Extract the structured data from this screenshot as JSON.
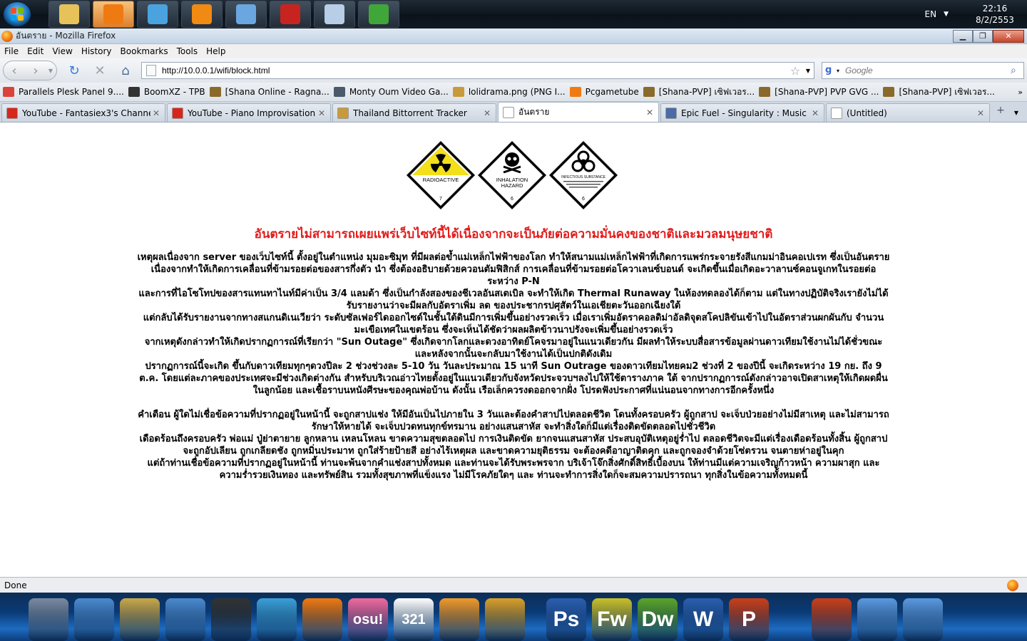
{
  "taskbar_top": {
    "apps": [
      {
        "name": "explorer",
        "color": "#e7c25b",
        "active": false
      },
      {
        "name": "firefox",
        "color": "#f07a12",
        "active": true
      },
      {
        "name": "messenger",
        "color": "#4aa3df",
        "active": false
      },
      {
        "name": "vlc",
        "color": "#f08a12",
        "active": false
      },
      {
        "name": "remote-desktop",
        "color": "#6aa7e0",
        "active": false
      },
      {
        "name": "filezilla",
        "color": "#c8241f",
        "active": false
      },
      {
        "name": "notes",
        "color": "#b8cde6",
        "active": false
      },
      {
        "name": "network",
        "color": "#41a63a",
        "active": false
      }
    ],
    "language": "EN",
    "time": "22:16",
    "date": "8/2/2553"
  },
  "window": {
    "title": "อันตราย - Mozilla Firefox"
  },
  "menu": [
    "File",
    "Edit",
    "View",
    "History",
    "Bookmarks",
    "Tools",
    "Help"
  ],
  "nav": {
    "url": "http://10.0.0.1/wifi/block.html",
    "search_placeholder": "Google"
  },
  "bookmarks": [
    {
      "label": "Parallels Plesk Panel 9....",
      "color": "#d9433a"
    },
    {
      "label": "BoomXZ - TPB",
      "color": "#333333"
    },
    {
      "label": "[Shana Online - Ragna...",
      "color": "#8a6a2a"
    },
    {
      "label": "Monty Oum Video Ga...",
      "color": "#4a5a6a"
    },
    {
      "label": "lolidrama.png (PNG I...",
      "color": "#c99a3a"
    },
    {
      "label": "Pcgametube",
      "color": "#f07a12"
    },
    {
      "label": "[Shana-PVP] เซิฟเวอร...",
      "color": "#8a6a2a"
    },
    {
      "label": "[Shana-PVP] PVP GVG ...",
      "color": "#8a6a2a"
    },
    {
      "label": "[Shana-PVP] เซิฟเวอร...",
      "color": "#8a6a2a"
    }
  ],
  "tabs": [
    {
      "label": "YouTube - Fantasiex3's Channel",
      "icon": "youtube",
      "color": "#d9261c",
      "active": false
    },
    {
      "label": "YouTube - Piano Improvisation ...",
      "icon": "youtube",
      "color": "#d9261c",
      "active": false
    },
    {
      "label": "Thailand Bittorrent Tracker",
      "icon": "tracker",
      "color": "#c99a3a",
      "active": false
    },
    {
      "label": "อันตราย",
      "icon": "page",
      "color": "#ffffff",
      "active": true
    },
    {
      "label": "Epic Fuel - Singularity : Music > ...",
      "icon": "epicfuel",
      "color": "#4a6aa8",
      "active": false
    },
    {
      "label": "(Untitled)",
      "icon": "page",
      "color": "#ffffff",
      "active": false
    }
  ],
  "content": {
    "signs": [
      {
        "name": "radioactive-sign",
        "label": "RADIOACTIVE",
        "number": "7",
        "bg": "#f3df1a"
      },
      {
        "name": "inhalation-hazard-sign",
        "label1": "INHALATION",
        "label2": "HAZARD",
        "number": "6",
        "bg": "#ffffff"
      },
      {
        "name": "infectious-substance-sign",
        "label": "INFECTIOUS SUBSTANCE",
        "number": "6",
        "bg": "#ffffff"
      }
    ],
    "heading": "อันตรายไม่สามารถเผยแพร่เว็บไซท์นี้ได้เนื่องจากจะเป็นภัยต่อความมั่นคงของชาติและมวลมนุษยชาติ",
    "paragraphs": [
      "เหตุผลเนื่องจาก server ของเว็บไซท์นี้ ตั้งอยู่ในตำแหน่ง มุมอะซิมุท ที่มีผลต่อข้ำแม่เหล็กไฟฟ้าของโลก ทำให้สนามแม่เหล็กไฟฟ้าที่เกิดการแพร่กระจายรังสีแกมม่าอินคอเปเรท ซึ่งเป็นอันตราย",
      "เนื่องจากทำให้เกิดการเคลื่อนที่ข้ามรอยต่อของสารกึ่งตัว นำ ซึ่งต้องอธิบายด้วยควอนตัมฟิสิกส์ การเคลื่อนที่ข้ามรอยต่อโควาเลนซ์บอนด์ จะเกิดขึ้นเมื่อเกิดอะวาลานซ์คอนจูเกทในรอยต่อระหว่าง P-N",
      "และการที่ไอโซโทปของสารแทนทาไนท์มีค่าเป็น 3/4 แลมด้า ซึ่งเป็นกำลังสองของชีเวลอันสเตเบิล จะทำให้เกิด Thermal Runaway ในห้องทดลองได้ก็ตาม แต่ในทางปฏิบัติจริงเรายังไม่ได้รับรายงานว่าจะมีผลกับอัตราเพิ่ม ลด ของประชากรปศุสัตว์ในเอเชียตะวันออกเฉียงใต้",
      "แต่กลับได้รับรายงานจากทางสแกนดิเนเวียว่า ระดับซัลเฟอร์ไดออกไซด์ในชั้นใต้ดินมีการเพิ่มขึ้นอย่างรวดเร็ว เมื่อเราเพิ่มอัตราคอลดิม่าอัลดิจุดสโคปลิขันเข้าไปในอัตราส่วนผกผันกับ จำนวนมะเขือเทศในเขตร้อน ซึ่งจะเห็นได้ชัดว่าผลผลิตข้าวนาปรังจะเพิ่มขึ้นอย่างรวดเร็ว",
      "จากเหตุดังกล่าวทำให้เกิดปรากฏการณ์ที่เรียกว่า \"Sun Outage\" ซึ่งเกิดจากโลกและดวงอาทิตย์โคจรมาอยู่ในแนวเดียวกัน มีผลทำให้ระบบสื่อสารข้อมูลผ่านดาวเทียมใช้งานไม่ได้ชั่วขณะ และหลังจากนั้นจะกลับมาใช้งานได้เป็นปกติดังเดิม",
      "ปรากฏการณ์นี้จะเกิด ขึ้นกับดาวเทียมทุกๆดวงปีละ 2 ช่วงช่วงละ 5-10 วัน วันละประมาณ 15 นาที Sun Outrage ของดาวเทียมไทยคม2 ช่วงที่ 2 ของปีนี้ จะเกิดระหว่าง 19 กย. ถึง 9 ต.ค. โดยแต่ละภาคของประเทศจะมีช่วงเกิดต่างกัน สำหรับบริเวณอ่าวไทยตั้งอยู่ในแนวเดียวกับจังหวัดประจวบฯลงไปให้ใช้ตารางภาค ใต้ จากปรากฏการณ์ดังกล่าวอาจเปิดสาเหตุให้เกิดผดผื่นในลูกน้อย และเชื้อราบนหนังศีรษะของคุณพ่อบ้าน ดังนั้น เรือเล็กควรงดออกจากฝั่ง โปรดฟังประกาศที่แน่นอนจากทางการอีกครั้งหนึ่ง",
      "",
      "คำเตือน ผู้ใดไม่เชื่อข้อความที่ปรากฏอยู่ในหน้านี้ จะถูกสาปแช่ง ให้มีอันเป็นไปภายใน 3 วันและต้องคำสาปไปตลอดชีวิต โดนทั้งครอบครัว ผู้ถูกสาป จะเจ็บป่วยอย่างไม่มีสาเหตุ และไม่สามารถรักษาให้หายได้ จะเจ็บปวดทนทุกข์ทรมาน อย่างแสนสาหัส จะทำสิ่งใดก็มีแต่เรื่องติดขัดตลอดไปชั่วชีวิต",
      "เดือดร้อนถึงครอบครัว พ่อแม่ ปู่ย่าตายาย ลูกหลาน เหลนโหลน ขาดความสุขตลอดไป การเงินติดขัด ยากจนแสนสาหัส ประสบอุบัติเหตุอยู่ร่ำไป ตลอดชีวิตจะมีแต่เรื่องเดือดร้อนทั้งสิ้น ผู้ถูกสาป จะถูกอัปเลียน ถูกเกลียดชัง ถูกหมิ่นประมาท ถูกใส่ร้ายป้ายสี อย่างไร้เหตุผล และขาดความยุติธรรม จะต้องคดีอาญาติดคุก และถูกจองจำด้วยโซ่ตรวน จนตายห่าอยู่ในคุก",
      "แต่ถ้าท่านเชื่อข้อความที่ปรากฏอยู่ในหน้านี้ ท่านจะพ้นจากคำแช่งสาปทั้งหมด และท่านจะได้รับพระพรจาก บริเจ้าโจ๊กสิ่งศักดิ์สิทธิ์เบื้องบน ให้ท่านมีแต่ความเจริญก้าวหน้า ความผาสุก และความร่ำรวยเงินทอง และทรัพย์สิน รวมทั้งสุขภาพที่แข็งแรง ไม่มีโรคภัยใดๆ และ ท่านจะทำการสิ่งใดก็จะสมความปรารถนา ทุกสิ่งในข้อความทั้งหมดนี้"
    ]
  },
  "status": "Done",
  "dock": [
    {
      "name": "lock-app",
      "color": "#7a8aa0",
      "text": ""
    },
    {
      "name": "computer-app",
      "color": "#4a8ad0",
      "text": ""
    },
    {
      "name": "user-folder-app",
      "color": "#c9a84a",
      "text": ""
    },
    {
      "name": "network-app",
      "color": "#4a8ad0",
      "text": ""
    },
    {
      "name": "wolf-app",
      "color": "#333333",
      "text": ""
    },
    {
      "name": "messenger-app",
      "color": "#3aa0d8",
      "text": ""
    },
    {
      "name": "firefox-app",
      "color": "#f07a12",
      "text": ""
    },
    {
      "name": "osu-app",
      "color": "#f06aa0",
      "text": "osu!"
    },
    {
      "name": "321-app",
      "color": "#ffffff",
      "text": "321"
    },
    {
      "name": "media-player-app",
      "color": "#f09a2a",
      "text": ""
    },
    {
      "name": "media-center-app",
      "color": "#d9a02a",
      "text": ""
    },
    {
      "name": "photoshop-app",
      "color": "#2a5fb0",
      "text": "Ps"
    },
    {
      "name": "fireworks-app",
      "color": "#c9c02a",
      "text": "Fw"
    },
    {
      "name": "dreamweaver-app",
      "color": "#5aa52a",
      "text": "Dw"
    },
    {
      "name": "word-app",
      "color": "#2a5fb0",
      "text": "W"
    },
    {
      "name": "powerpoint-app",
      "color": "#c9401a",
      "text": "P"
    },
    {
      "name": "3d-app",
      "color": "#c9401a",
      "text": ""
    },
    {
      "name": "settings-app-1",
      "color": "#5a9ae0",
      "text": ""
    },
    {
      "name": "settings-app-2",
      "color": "#5a9ae0",
      "text": ""
    }
  ]
}
